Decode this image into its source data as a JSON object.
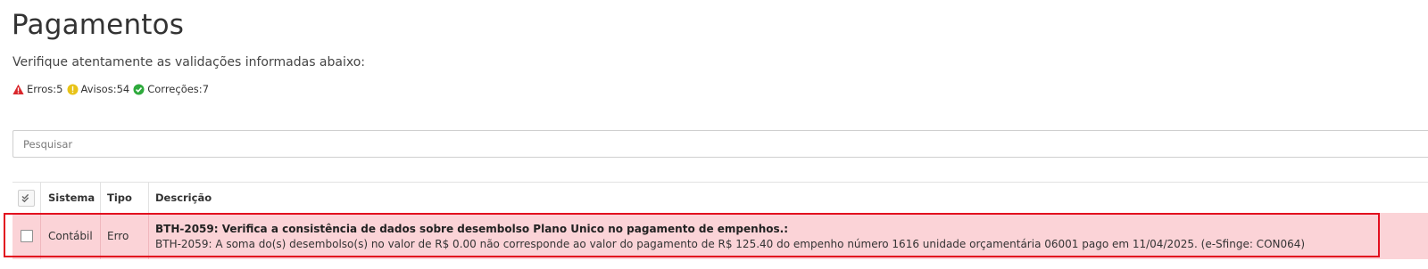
{
  "page": {
    "title": "Pagamentos",
    "subtitle": "Verifique atentamente as validações informadas abaixo:"
  },
  "counters": [
    {
      "label": "Erros:",
      "value": "5",
      "icon": "warning-triangle-icon",
      "color": "#d9262b"
    },
    {
      "label": "Avisos:",
      "value": "54",
      "icon": "alert-circle-icon",
      "color": "#e8c318"
    },
    {
      "label": "Correções:",
      "value": "7",
      "icon": "check-circle-icon",
      "color": "#2eaa3c"
    }
  ],
  "search": {
    "placeholder": "Pesquisar",
    "value": ""
  },
  "grid": {
    "columns": {
      "select_all_icon": "double-check-icon",
      "sistema": "Sistema",
      "tipo": "Tipo",
      "descricao": "Descrição"
    },
    "rows": [
      {
        "sistema": "Contábil",
        "tipo": "Erro",
        "title": "BTH-2059: Verifica a consistência de dados sobre desembolso Plano Unico no pagamento de empenhos.:",
        "text": "BTH-2059: A soma do(s) desembolso(s) no valor de R$ 0.00 não corresponde ao valor do pagamento de R$ 125.40 do empenho número 1616 unidade orçamentária 06001 pago em 11/04/2025. (e-Sfinge: CON064)",
        "checked": false,
        "highlight_color": "#fbd3d7",
        "outline_color": "#e2101f"
      }
    ]
  }
}
